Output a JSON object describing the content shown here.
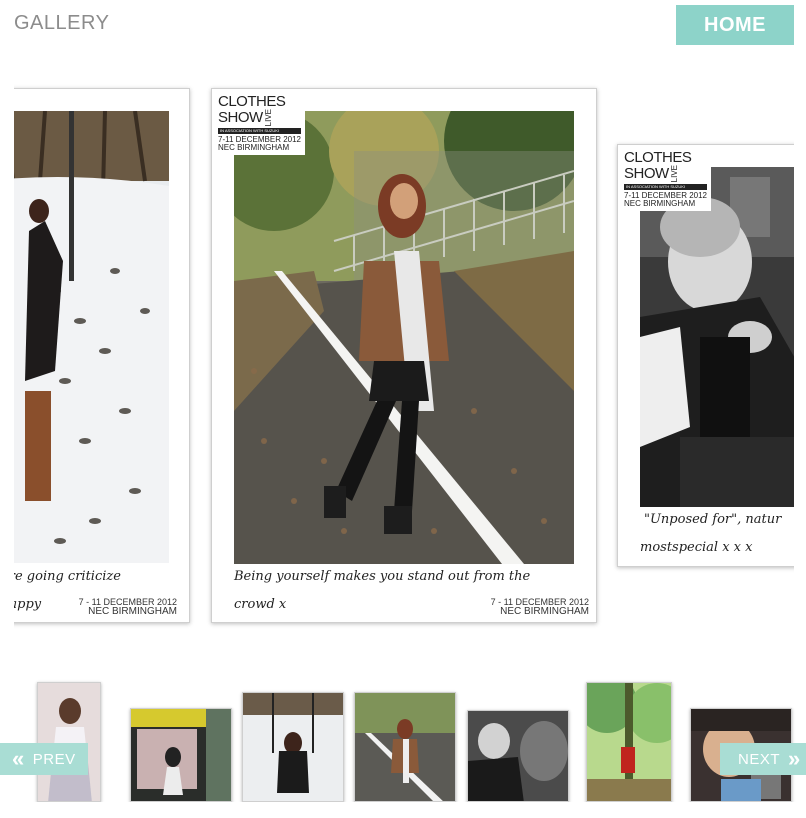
{
  "header": {
    "title": "GALLERY",
    "home_label": "HOME"
  },
  "slides": [
    {
      "caption_line1": "are going criticize",
      "caption_line2": "happy",
      "event_date": "7 - 11 DECEMBER 2012",
      "event_venue": "NEC BIRMINGHAM"
    },
    {
      "logo": {
        "line1": "CLOTHES",
        "line2": "SHOW",
        "live": "LIVE",
        "strip": "IN ASSOCIATION WITH SUZUKI",
        "date": "7-11 DECEMBER 2012",
        "venue": "NEC BIRMINGHAM"
      },
      "caption_line1": "Being yourself makes you stand out from the",
      "caption_line2": "crowd x",
      "event_date": "7 - 11 DECEMBER 2012",
      "event_venue": "NEC BIRMINGHAM"
    },
    {
      "logo": {
        "line1": "CLOTHES",
        "line2": "SHOW",
        "live": "LIVE",
        "strip": "IN ASSOCIATION WITH SUZUKI",
        "date": "7-11 DECEMBER 2012",
        "venue": "NEC BIRMINGHAM"
      },
      "caption_line1": "\"Unposed for\", natur",
      "caption_line2": "mostspecial x x x"
    }
  ],
  "carousel": {
    "prev_label": "PREV",
    "next_label": "NEXT"
  },
  "colors": {
    "accent": "#8dd3c9",
    "nav_button": "#a9ddd4"
  }
}
